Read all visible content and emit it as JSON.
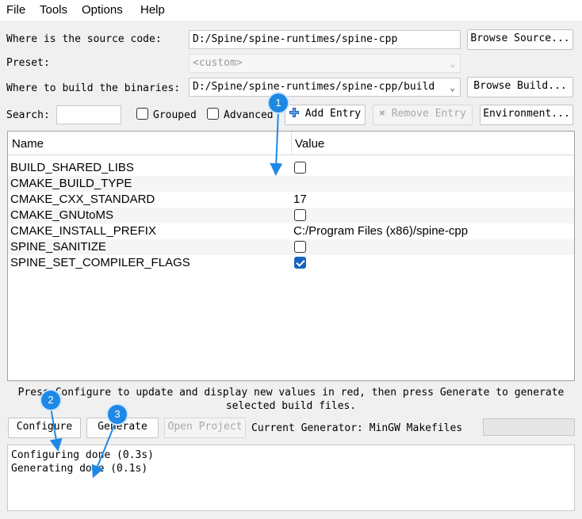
{
  "menu": [
    "File",
    "Tools",
    "Options",
    "Help"
  ],
  "source": {
    "label": "Where is the source code:",
    "value": "D:/Spine/spine-runtimes/spine-cpp",
    "button": "Browse Source..."
  },
  "preset": {
    "label": "Preset:",
    "value": "<custom>"
  },
  "build": {
    "label": "Where to build the binaries:",
    "value": "D:/Spine/spine-runtimes/spine-cpp/build",
    "button": "Browse Build..."
  },
  "toolbar": {
    "search_label": "Search:",
    "search_value": "",
    "grouped": "Grouped",
    "advanced": "Advanced",
    "add_entry": "Add Entry",
    "remove_entry": "Remove Entry",
    "environment": "Environment..."
  },
  "table": {
    "headers": [
      "Name",
      "Value"
    ],
    "rows": [
      {
        "name": "BUILD_SHARED_LIBS",
        "type": "bool",
        "checked": false,
        "value": ""
      },
      {
        "name": "CMAKE_BUILD_TYPE",
        "type": "text",
        "checked": false,
        "value": ""
      },
      {
        "name": "CMAKE_CXX_STANDARD",
        "type": "text",
        "checked": false,
        "value": "17"
      },
      {
        "name": "CMAKE_GNUtoMS",
        "type": "bool",
        "checked": false,
        "value": ""
      },
      {
        "name": "CMAKE_INSTALL_PREFIX",
        "type": "text",
        "checked": false,
        "value": "C:/Program Files (x86)/spine-cpp"
      },
      {
        "name": "SPINE_SANITIZE",
        "type": "bool",
        "checked": false,
        "value": ""
      },
      {
        "name": "SPINE_SET_COMPILER_FLAGS",
        "type": "bool",
        "checked": true,
        "value": ""
      }
    ]
  },
  "hint": [
    "Press Configure to update and display new values in red, then press Generate to generate",
    "selected build files."
  ],
  "actions": {
    "configure": "Configure",
    "generate": "Generate",
    "open_project": "Open Project",
    "current_generator": "Current Generator: MinGW Makefiles"
  },
  "output": [
    "Configuring done (0.3s)",
    "Generating done (0.1s)"
  ],
  "annotations": [
    "1",
    "2",
    "3"
  ],
  "colors": {
    "accent": "#1e88e5",
    "checkbox_checked": "#1565c0"
  }
}
